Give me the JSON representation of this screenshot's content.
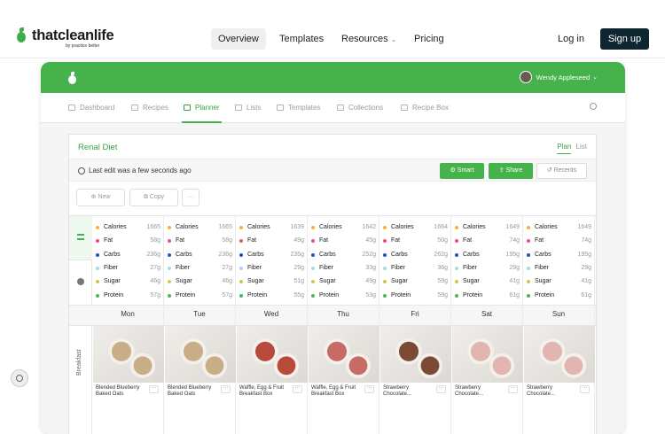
{
  "site": {
    "brand_name": "thatcleanlife",
    "brand_sub": "by practice better",
    "nav": [
      {
        "label": "Overview"
      },
      {
        "label": "Templates"
      },
      {
        "label": "Resources"
      },
      {
        "label": "Pricing"
      }
    ],
    "login": "Log in",
    "signup": "Sign up"
  },
  "app": {
    "user": "Wendy Appleseed",
    "tabs": [
      {
        "label": "Dashboard"
      },
      {
        "label": "Recipes"
      },
      {
        "label": "Planner"
      },
      {
        "label": "Lists"
      },
      {
        "label": "Templates"
      },
      {
        "label": "Collections"
      },
      {
        "label": "Recipe Box"
      }
    ],
    "panel_title": "Renal Diet",
    "view_plan": "Plan",
    "view_list": "List",
    "last_edit": "Last edit was a few seconds ago",
    "btn_smart": "Smart",
    "btn_share": "Share",
    "btn_recents": "Recents",
    "btn_new": "New",
    "btn_copy": "Copy",
    "btn_more": "···",
    "meal_label": "Breakfast",
    "nutrient_names": [
      "Calories",
      "Fat",
      "Carbs",
      "Fiber",
      "Sugar",
      "Protein"
    ],
    "nutrient_colors": [
      "#f2b52d",
      "#ef4f84",
      "#2b4dd3",
      "#a9d7ea",
      "#d4c54a",
      "#4fb55a"
    ],
    "days": [
      {
        "name": "Mon",
        "values": [
          "1665",
          "58g",
          "236g",
          "27g",
          "46g",
          "57g"
        ],
        "meal": "Blended Blueberry Baked Oats"
      },
      {
        "name": "Tue",
        "values": [
          "1665",
          "58g",
          "236g",
          "27g",
          "46g",
          "57g"
        ],
        "meal": "Blended Blueberry Baked Oats"
      },
      {
        "name": "Wed",
        "values": [
          "1639",
          "49g",
          "235g",
          "29g",
          "51g",
          "55g"
        ],
        "meal": "Waffle, Egg & Fruit Breakfast Box"
      },
      {
        "name": "Thu",
        "values": [
          "1642",
          "45g",
          "252g",
          "33g",
          "49g",
          "53g"
        ],
        "meal": "Waffle, Egg & Fruit Breakfast Box"
      },
      {
        "name": "Fri",
        "values": [
          "1664",
          "50g",
          "262g",
          "36g",
          "59g",
          "59g"
        ],
        "meal": "Strawberry Chocolate..."
      },
      {
        "name": "Sat",
        "values": [
          "1649",
          "74g",
          "195g",
          "29g",
          "41g",
          "61g"
        ],
        "meal": "Strawberry Chocolate..."
      },
      {
        "name": "Sun",
        "values": [
          "1649",
          "74g",
          "195g",
          "29g",
          "41g",
          "61g"
        ],
        "meal": "Strawberry Chocolate..."
      }
    ],
    "meal_image_colors": [
      "#c8ae86",
      "#c8ae86",
      "#b74a3b",
      "#c86b66",
      "#7a4a35",
      "#e2b6b0",
      "#e2b6b0"
    ]
  }
}
